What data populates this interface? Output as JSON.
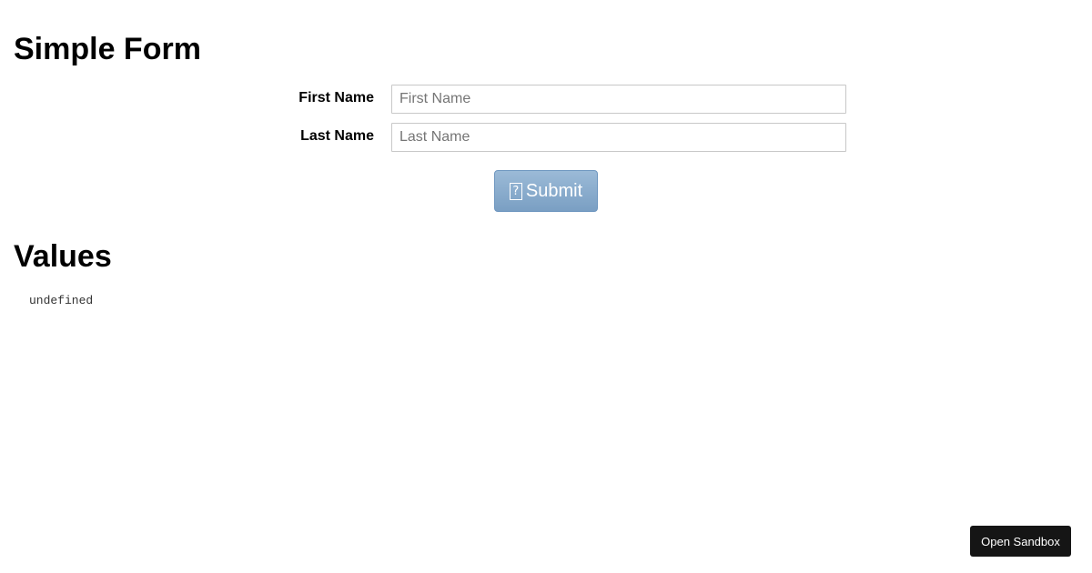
{
  "form": {
    "title": "Simple Form",
    "fields": [
      {
        "label": "First Name",
        "placeholder": "First Name",
        "value": ""
      },
      {
        "label": "Last Name",
        "placeholder": "Last Name",
        "value": ""
      }
    ],
    "submit_label": "Submit",
    "submit_icon": "missing-glyph-icon",
    "submit_icon_glyph": "?"
  },
  "values": {
    "title": "Values",
    "output": "undefined"
  },
  "sandbox": {
    "label": "Open Sandbox"
  },
  "colors": {
    "submit_bg": "#8aadce",
    "sandbox_bg": "#151515"
  }
}
